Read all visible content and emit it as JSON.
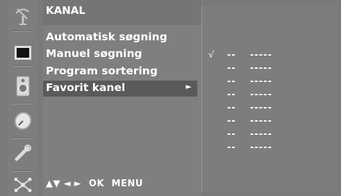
{
  "menu": {
    "title": "KANAL",
    "items": [
      {
        "label": "Automatisk søgning"
      },
      {
        "label": "Manuel søgning"
      },
      {
        "label": "Program sortering"
      },
      {
        "label": "Favorit kanel",
        "arrow": "►"
      }
    ]
  },
  "hint": {
    "arrows": "▲▼  ◄ ►",
    "ok": "OK",
    "menu": "MENU"
  },
  "icons": [
    "antenna-icon",
    "screen-icon",
    "speaker-icon",
    "clock-icon",
    "wrench-icon",
    "network-icon"
  ],
  "favorites": [
    {
      "check": "√",
      "number": "--",
      "name": "-----"
    },
    {
      "check": "",
      "number": "--",
      "name": "-----"
    },
    {
      "check": "",
      "number": "--",
      "name": "-----"
    },
    {
      "check": "",
      "number": "--",
      "name": "-----"
    },
    {
      "check": "",
      "number": "--",
      "name": "-----"
    },
    {
      "check": "",
      "number": "--",
      "name": "-----"
    },
    {
      "check": "",
      "number": "--",
      "name": "-----"
    },
    {
      "check": "",
      "number": "--",
      "name": "-----"
    }
  ]
}
